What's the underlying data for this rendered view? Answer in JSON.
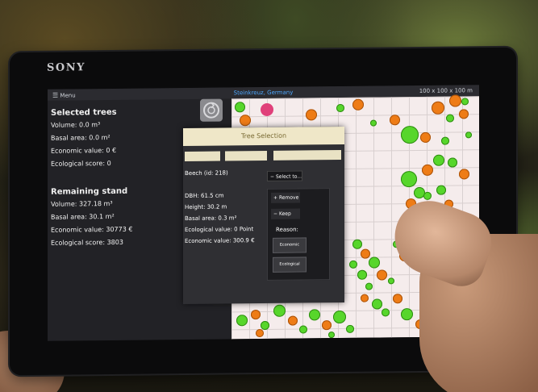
{
  "device": {
    "brand": "SONY"
  },
  "topbar": {
    "menu_label": "Menu",
    "location": "Steinkreuz, Germany",
    "dimensions": "100 x 100 x 100 m"
  },
  "selected": {
    "heading": "Selected trees",
    "volume": "Volume: 0.0 m³",
    "basal_area": "Basal area: 0.0 m²",
    "economic_value": "Economic value: 0 €",
    "ecological_score": "Ecological score: 0"
  },
  "remaining": {
    "heading": "Remaining stand",
    "volume": "Volume: 327.18 m³",
    "basal_area": "Basal area: 30.1 m²",
    "economic_value": "Economic value: 30773 €",
    "ecological_score": "Ecological score: 3803"
  },
  "dialog": {
    "title": "Tree Selection",
    "buttons": [
      "",
      "",
      ""
    ],
    "species": "Beech (id: 218)",
    "dbh": "DBH: 61.5 cm",
    "height": "Height: 30.2 m",
    "basal_area": "Basal area: 0.3 m²",
    "ecological_value": "Ecological value: 0 Point",
    "economic_value": "Economic value: 300.9 €",
    "select_label": "Select to...",
    "remove_label": "Remove",
    "keep_label": "Keep",
    "reason_label": "Reason:",
    "economic_button": "Economic",
    "ecological_button": "Ecological"
  },
  "colors": {
    "retained_tree": "#57d62b",
    "harvested_tree": "#ee7c16",
    "selected_tree": "#e0407a",
    "location_text": "#4ea8ff"
  },
  "icons": [
    "menu-icon",
    "recycle-icon",
    "back-icon",
    "home-icon",
    "recents-icon"
  ]
}
